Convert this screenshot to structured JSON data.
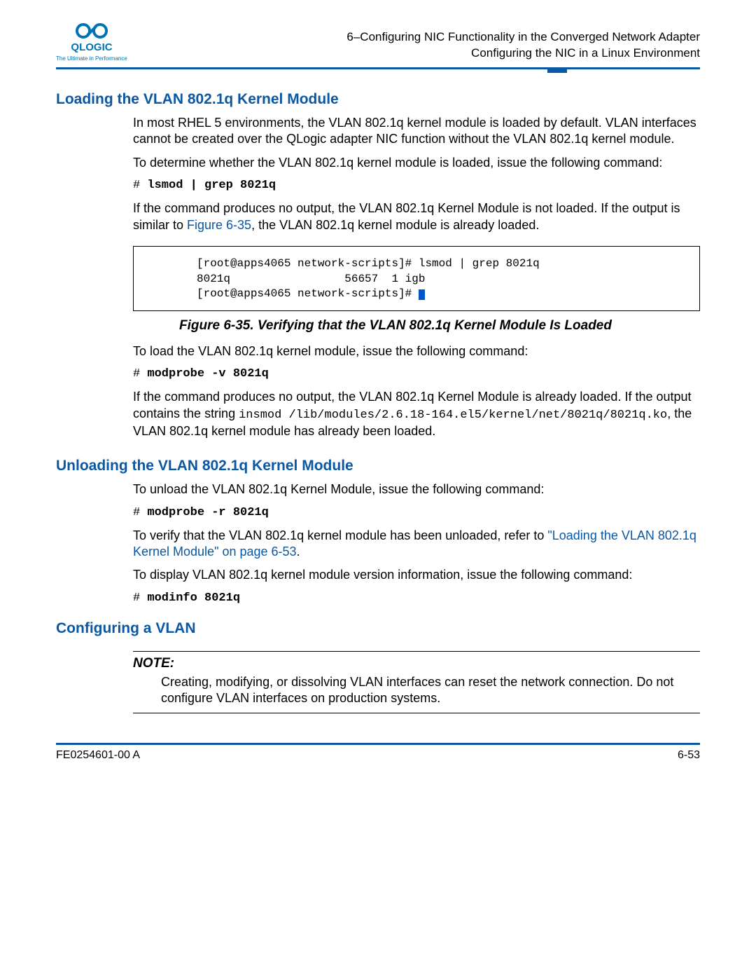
{
  "logo": {
    "brand": "QLOGIC",
    "tagline": "The Ultimate in Performance"
  },
  "header": {
    "line1": "6–Configuring NIC Functionality in the Converged Network Adapter",
    "line2": "Configuring the NIC in a Linux Environment"
  },
  "sectionA": {
    "title": "Loading the VLAN 802.1q Kernel Module",
    "p1": "In most RHEL 5 environments, the VLAN 802.1q kernel module is loaded by default. VLAN interfaces cannot be created over the QLogic adapter NIC function without the VLAN 802.1q kernel module.",
    "p2": "To determine whether the VLAN 802.1q kernel module is loaded, issue the following command:",
    "cmd1": "lsmod | grep 8021q",
    "p3a": "If the command produces no output, the VLAN 802.1q Kernel Module is not loaded. If the output is similar to ",
    "p3link": "Figure 6-35",
    "p3b": ", the VLAN 802.1q kernel module is already loaded."
  },
  "figure": {
    "line1": "[root@apps4065 network-scripts]# lsmod | grep 8021q",
    "line2": "8021q                 56657  1 igb",
    "line3": "[root@apps4065 network-scripts]# ",
    "caption": "Figure 6-35. Verifying that the VLAN 802.1q Kernel Module Is Loaded"
  },
  "afterFigure": {
    "p1": "To load the VLAN 802.1q kernel module, issue the following command:",
    "cmd1": "modprobe -v 8021q",
    "p2a": "If the command produces no output, the VLAN 802.1q Kernel Module is already loaded. If the output contains the string ",
    "p2mono1": "insmod /lib/modules/2.6.18-164.el5/kernel/net/8021q/8021q.ko",
    "p2b": ", the VLAN 802.1q kernel module has already been loaded."
  },
  "sectionB": {
    "title": "Unloading the VLAN 802.1q Kernel Module",
    "p1": "To unload the VLAN 802.1q Kernel Module, issue the following command:",
    "cmd1": "modprobe -r 8021q",
    "p2a": "To verify that the VLAN 802.1q kernel module has been unloaded, refer to ",
    "p2link": "\"Loading the VLAN 802.1q Kernel Module\" on page 6-53",
    "p2b": ".",
    "p3": "To display VLAN 802.1q kernel module version information, issue the following command:",
    "cmd2": "modinfo 8021q"
  },
  "sectionC": {
    "title": "Configuring a VLAN",
    "note_label": "NOTE:",
    "note_text": "Creating, modifying, or dissolving VLAN interfaces can reset the network connection. Do not configure VLAN interfaces on production systems."
  },
  "footer": {
    "left": "FE0254601-00 A",
    "right": "6-53"
  }
}
